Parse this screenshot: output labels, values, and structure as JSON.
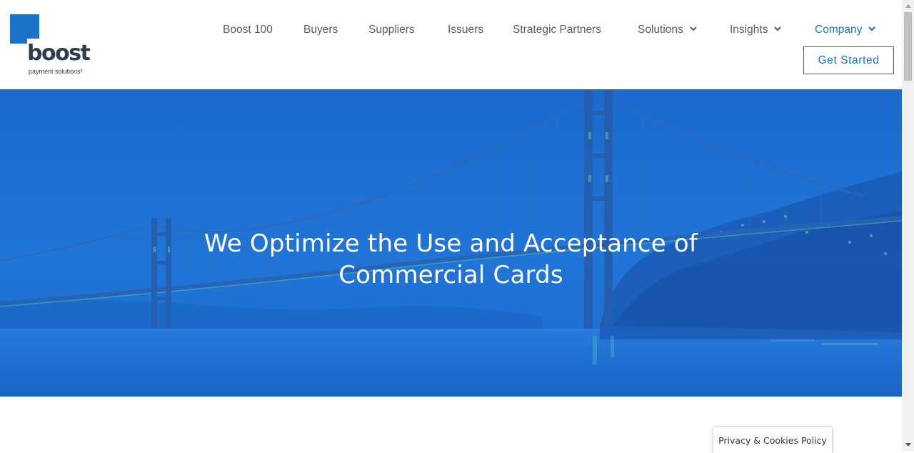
{
  "brand": {
    "name": "boost",
    "tagline": "payment solutions³",
    "accent": "#1a73c9",
    "text_dark": "#2e3d4d"
  },
  "nav": {
    "items": [
      {
        "label": "Boost 100",
        "has_dropdown": false,
        "active": false
      },
      {
        "label": "Buyers",
        "has_dropdown": false,
        "active": false
      },
      {
        "label": "Suppliers",
        "has_dropdown": false,
        "active": false
      },
      {
        "label": "Issuers",
        "has_dropdown": false,
        "active": false
      },
      {
        "label": "Strategic Partners",
        "has_dropdown": false,
        "active": false
      },
      {
        "label": "Solutions",
        "has_dropdown": true,
        "icon": "chevron-down-icon",
        "active": false
      },
      {
        "label": "Insights",
        "has_dropdown": true,
        "icon": "chevron-down-icon",
        "active": false
      },
      {
        "label": "Company",
        "has_dropdown": true,
        "icon": "chevron-down-icon",
        "active": true
      }
    ],
    "cta_label": "Get Started"
  },
  "hero": {
    "title_line1": "We Optimize the Use and Acceptance of",
    "title_line2": "Commercial Cards",
    "overlay_color": "#1d6fd4"
  },
  "privacy": {
    "label": "Privacy & Cookies Policy"
  }
}
